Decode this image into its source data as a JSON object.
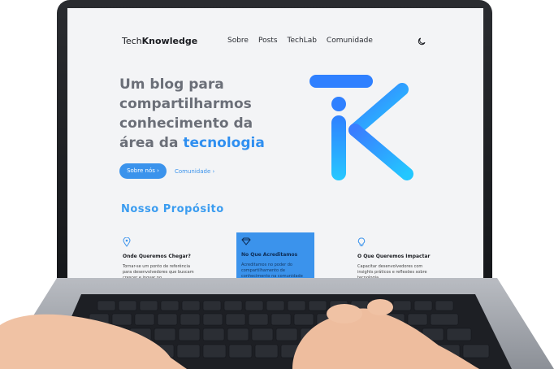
{
  "nav": {
    "brand_light": "Tech",
    "brand_bold": "Knowledge",
    "items": [
      {
        "label": "Sobre"
      },
      {
        "label": "Posts"
      },
      {
        "label": "TechLab"
      },
      {
        "label": "Comunidade"
      }
    ],
    "theme_icon": "moon-icon"
  },
  "hero": {
    "title_line1": "Um blog para",
    "title_line2": "compartilharmos",
    "title_line3": "conhecimento da",
    "title_line4_prefix": "área da ",
    "title_line4_accent": "tecnologia",
    "primary_button": "Sobre nós  ›",
    "secondary_link": "Comunidade  ›"
  },
  "section": {
    "title": "Nosso Propósito"
  },
  "cards": [
    {
      "icon": "location-pin-icon",
      "title": "Onde Queremos Chegar?",
      "desc": "Tornar-se um ponto de referência para desenvolvedores que buscam crescer e inovar no"
    },
    {
      "icon": "diamond-icon",
      "title": "No Que Acreditamos",
      "desc": "Acreditamos no poder do compartilhamento de conhecimento na comunidade"
    },
    {
      "icon": "lightbulb-icon",
      "title": "O Que Queremos Impactar",
      "desc": "Capacitar desenvolvedores com insights práticos e reflexões sobre tecnologia"
    }
  ],
  "colors": {
    "accent": "#3b93ec",
    "accent_light": "#2ad0ff",
    "text_dark": "#1b1d22",
    "text_muted": "#6b6f78"
  }
}
